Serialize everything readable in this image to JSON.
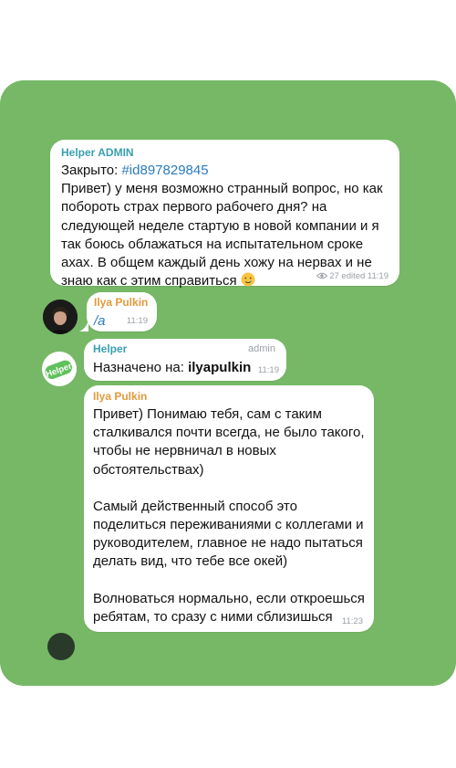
{
  "colors": {
    "background": "#76b866",
    "admin_name": "#3a9fb0",
    "user_name": "#e39a3b",
    "link": "#2a7bbd"
  },
  "msg1": {
    "sender": "Helper ADMIN",
    "closed_label": "Закрыто: ",
    "hashtag": "#id897829845",
    "body": "Привет) у меня возможно странный вопрос, но как побороть страх первого рабочего дня? на следующей неделе стартую в новой компании и я так боюсь облажаться на испытательном сроке ахах. В общем каждый день хожу на нервах и не знаю как с этим справиться",
    "emoji": "smiling-tear-emoji",
    "views": "27",
    "edited": "edited 11:19"
  },
  "msg2": {
    "sender": "Ilya Pulkin",
    "body": "/a",
    "time": "11:19"
  },
  "msg3": {
    "sender": "Helper",
    "role": "admin",
    "prefix": "Назначено на: ",
    "assignee": "ilyapulkin",
    "time": "11:19",
    "avatar_text": "Helper"
  },
  "msg4": {
    "sender": "Ilya Pulkin",
    "p1": "Привет) Понимаю тебя, сам с таким сталкивался почти всегда, не было такого, чтобы не нервничал в новых обстоятельствах)",
    "p2": "Самый действенный способ это поделиться переживаниями с коллегами и руководителем, главное не надо пытаться делать вид, что тебе все окей)",
    "p3": "Волноваться нормально, если откроешься ребятам, то сразу с ними сблизишься",
    "time": "11:23"
  }
}
